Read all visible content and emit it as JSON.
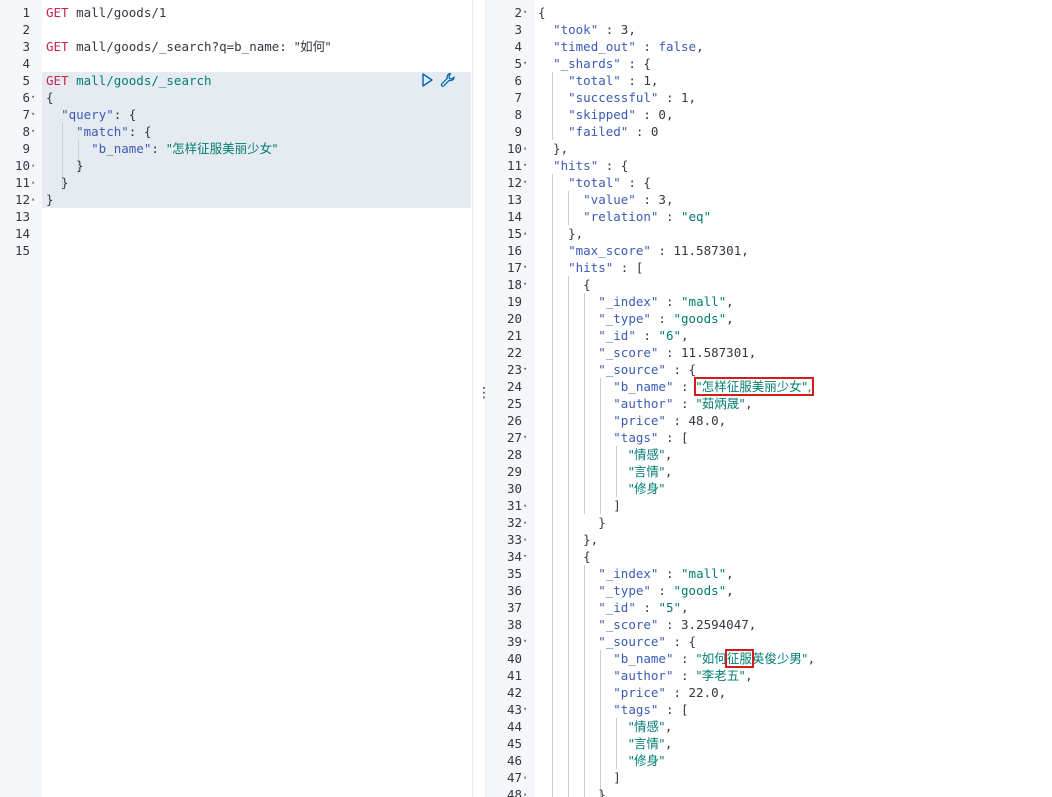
{
  "left_editor": {
    "lines": [
      {
        "n": "1",
        "code": [
          {
            "t": "GET",
            "c": "m"
          },
          {
            "t": " mall/goods/1",
            "c": "u"
          }
        ]
      },
      {
        "n": "2",
        "code": []
      },
      {
        "n": "3",
        "code": [
          {
            "t": "GET",
            "c": "m"
          },
          {
            "t": " mall/goods/_search?q=b_name: ",
            "c": "u"
          },
          {
            "t": "\"如何\"",
            "c": "u"
          }
        ]
      },
      {
        "n": "4",
        "code": []
      },
      {
        "n": "5",
        "code": [
          {
            "t": "GET",
            "c": "m"
          },
          {
            "t": " mall/goods/_search",
            "c": "s"
          }
        ]
      },
      {
        "n": "6",
        "fold": "▾",
        "code": [
          {
            "t": "{",
            "c": "p"
          }
        ]
      },
      {
        "n": "7",
        "fold": "▾",
        "code": [
          {
            "t": "  ",
            "c": "p"
          },
          {
            "t": "\"query\"",
            "c": "k"
          },
          {
            "t": ": {",
            "c": "p"
          }
        ]
      },
      {
        "n": "8",
        "fold": "▾",
        "code": [
          {
            "t": "    ",
            "c": "p"
          },
          {
            "t": "\"match\"",
            "c": "k"
          },
          {
            "t": ": {",
            "c": "p"
          }
        ]
      },
      {
        "n": "9",
        "code": [
          {
            "t": "      ",
            "c": "p"
          },
          {
            "t": "\"b_name\"",
            "c": "k"
          },
          {
            "t": ": ",
            "c": "p"
          },
          {
            "t": "\"怎样征服美丽少女\"",
            "c": "s"
          }
        ]
      },
      {
        "n": "10",
        "fold": "▴",
        "code": [
          {
            "t": "    }",
            "c": "p"
          }
        ]
      },
      {
        "n": "11",
        "fold": "▴",
        "code": [
          {
            "t": "  }",
            "c": "p"
          }
        ]
      },
      {
        "n": "12",
        "fold": "▴",
        "code": [
          {
            "t": "}",
            "c": "p"
          }
        ]
      },
      {
        "n": "13",
        "code": []
      },
      {
        "n": "14",
        "code": []
      },
      {
        "n": "15",
        "code": []
      }
    ]
  },
  "action_bar": {
    "run_icon": "play-icon",
    "settings_icon": "wrench-icon"
  },
  "divider": {
    "handle": "⋮"
  },
  "right_editor": {
    "lines": [
      {
        "n": "2",
        "fold": "▾",
        "code": [
          {
            "t": "{",
            "c": "p"
          }
        ]
      },
      {
        "n": "3",
        "code": [
          {
            "t": "  ",
            "c": "p"
          },
          {
            "t": "\"took\"",
            "c": "k"
          },
          {
            "t": " : ",
            "c": "p"
          },
          {
            "t": "3",
            "c": "n"
          },
          {
            "t": ",",
            "c": "p"
          }
        ]
      },
      {
        "n": "4",
        "code": [
          {
            "t": "  ",
            "c": "p"
          },
          {
            "t": "\"timed_out\"",
            "c": "k"
          },
          {
            "t": " : ",
            "c": "p"
          },
          {
            "t": "false",
            "c": "k"
          },
          {
            "t": ",",
            "c": "p"
          }
        ]
      },
      {
        "n": "5",
        "fold": "▾",
        "code": [
          {
            "t": "  ",
            "c": "p"
          },
          {
            "t": "\"_shards\"",
            "c": "k"
          },
          {
            "t": " : {",
            "c": "p"
          }
        ]
      },
      {
        "n": "6",
        "code": [
          {
            "t": "    ",
            "c": "p"
          },
          {
            "t": "\"total\"",
            "c": "k"
          },
          {
            "t": " : ",
            "c": "p"
          },
          {
            "t": "1",
            "c": "n"
          },
          {
            "t": ",",
            "c": "p"
          }
        ]
      },
      {
        "n": "7",
        "code": [
          {
            "t": "    ",
            "c": "p"
          },
          {
            "t": "\"successful\"",
            "c": "k"
          },
          {
            "t": " : ",
            "c": "p"
          },
          {
            "t": "1",
            "c": "n"
          },
          {
            "t": ",",
            "c": "p"
          }
        ]
      },
      {
        "n": "8",
        "code": [
          {
            "t": "    ",
            "c": "p"
          },
          {
            "t": "\"skipped\"",
            "c": "k"
          },
          {
            "t": " : ",
            "c": "p"
          },
          {
            "t": "0",
            "c": "n"
          },
          {
            "t": ",",
            "c": "p"
          }
        ]
      },
      {
        "n": "9",
        "code": [
          {
            "t": "    ",
            "c": "p"
          },
          {
            "t": "\"failed\"",
            "c": "k"
          },
          {
            "t": " : ",
            "c": "p"
          },
          {
            "t": "0",
            "c": "n"
          }
        ]
      },
      {
        "n": "10",
        "fold": "▴",
        "code": [
          {
            "t": "  },",
            "c": "p"
          }
        ]
      },
      {
        "n": "11",
        "fold": "▾",
        "code": [
          {
            "t": "  ",
            "c": "p"
          },
          {
            "t": "\"hits\"",
            "c": "k"
          },
          {
            "t": " : {",
            "c": "p"
          }
        ]
      },
      {
        "n": "12",
        "fold": "▾",
        "code": [
          {
            "t": "    ",
            "c": "p"
          },
          {
            "t": "\"total\"",
            "c": "k"
          },
          {
            "t": " : {",
            "c": "p"
          }
        ]
      },
      {
        "n": "13",
        "code": [
          {
            "t": "      ",
            "c": "p"
          },
          {
            "t": "\"value\"",
            "c": "k"
          },
          {
            "t": " : ",
            "c": "p"
          },
          {
            "t": "3",
            "c": "n"
          },
          {
            "t": ",",
            "c": "p"
          }
        ]
      },
      {
        "n": "14",
        "code": [
          {
            "t": "      ",
            "c": "p"
          },
          {
            "t": "\"relation\"",
            "c": "k"
          },
          {
            "t": " : ",
            "c": "p"
          },
          {
            "t": "\"eq\"",
            "c": "s"
          }
        ]
      },
      {
        "n": "15",
        "fold": "▴",
        "code": [
          {
            "t": "    },",
            "c": "p"
          }
        ]
      },
      {
        "n": "16",
        "code": [
          {
            "t": "    ",
            "c": "p"
          },
          {
            "t": "\"max_score\"",
            "c": "k"
          },
          {
            "t": " : ",
            "c": "p"
          },
          {
            "t": "11.587301",
            "c": "n"
          },
          {
            "t": ",",
            "c": "p"
          }
        ]
      },
      {
        "n": "17",
        "fold": "▾",
        "code": [
          {
            "t": "    ",
            "c": "p"
          },
          {
            "t": "\"hits\"",
            "c": "k"
          },
          {
            "t": " : [",
            "c": "p"
          }
        ]
      },
      {
        "n": "18",
        "fold": "▾",
        "code": [
          {
            "t": "      {",
            "c": "p"
          }
        ]
      },
      {
        "n": "19",
        "code": [
          {
            "t": "        ",
            "c": "p"
          },
          {
            "t": "\"_index\"",
            "c": "k"
          },
          {
            "t": " : ",
            "c": "p"
          },
          {
            "t": "\"mall\"",
            "c": "s"
          },
          {
            "t": ",",
            "c": "p"
          }
        ]
      },
      {
        "n": "20",
        "code": [
          {
            "t": "        ",
            "c": "p"
          },
          {
            "t": "\"_type\"",
            "c": "k"
          },
          {
            "t": " : ",
            "c": "p"
          },
          {
            "t": "\"goods\"",
            "c": "s"
          },
          {
            "t": ",",
            "c": "p"
          }
        ]
      },
      {
        "n": "21",
        "code": [
          {
            "t": "        ",
            "c": "p"
          },
          {
            "t": "\"_id\"",
            "c": "k"
          },
          {
            "t": " : ",
            "c": "p"
          },
          {
            "t": "\"6\"",
            "c": "s"
          },
          {
            "t": ",",
            "c": "p"
          }
        ]
      },
      {
        "n": "22",
        "code": [
          {
            "t": "        ",
            "c": "p"
          },
          {
            "t": "\"_score\"",
            "c": "k"
          },
          {
            "t": " : ",
            "c": "p"
          },
          {
            "t": "11.587301",
            "c": "n"
          },
          {
            "t": ",",
            "c": "p"
          }
        ]
      },
      {
        "n": "23",
        "fold": "▾",
        "code": [
          {
            "t": "        ",
            "c": "p"
          },
          {
            "t": "\"_source\"",
            "c": "k"
          },
          {
            "t": " : {",
            "c": "p"
          }
        ]
      },
      {
        "n": "24",
        "code": [
          {
            "t": "          ",
            "c": "p"
          },
          {
            "t": "\"b_name\"",
            "c": "k"
          },
          {
            "t": " : ",
            "c": "p"
          },
          {
            "t": "\"怎样征服美丽少女\",",
            "c": "s",
            "hl": true
          }
        ]
      },
      {
        "n": "25",
        "code": [
          {
            "t": "          ",
            "c": "p"
          },
          {
            "t": "\"author\"",
            "c": "k"
          },
          {
            "t": " : ",
            "c": "p"
          },
          {
            "t": "\"茹炳晟\"",
            "c": "s"
          },
          {
            "t": ",",
            "c": "p"
          }
        ]
      },
      {
        "n": "26",
        "code": [
          {
            "t": "          ",
            "c": "p"
          },
          {
            "t": "\"price\"",
            "c": "k"
          },
          {
            "t": " : ",
            "c": "p"
          },
          {
            "t": "48.0",
            "c": "n"
          },
          {
            "t": ",",
            "c": "p"
          }
        ]
      },
      {
        "n": "27",
        "fold": "▾",
        "code": [
          {
            "t": "          ",
            "c": "p"
          },
          {
            "t": "\"tags\"",
            "c": "k"
          },
          {
            "t": " : [",
            "c": "p"
          }
        ]
      },
      {
        "n": "28",
        "code": [
          {
            "t": "            ",
            "c": "p"
          },
          {
            "t": "\"情感\"",
            "c": "s"
          },
          {
            "t": ",",
            "c": "p"
          }
        ]
      },
      {
        "n": "29",
        "code": [
          {
            "t": "            ",
            "c": "p"
          },
          {
            "t": "\"言情\"",
            "c": "s"
          },
          {
            "t": ",",
            "c": "p"
          }
        ]
      },
      {
        "n": "30",
        "code": [
          {
            "t": "            ",
            "c": "p"
          },
          {
            "t": "\"修身\"",
            "c": "s"
          }
        ]
      },
      {
        "n": "31",
        "fold": "▴",
        "code": [
          {
            "t": "          ]",
            "c": "p"
          }
        ]
      },
      {
        "n": "32",
        "fold": "▴",
        "code": [
          {
            "t": "        }",
            "c": "p"
          }
        ]
      },
      {
        "n": "33",
        "fold": "▴",
        "code": [
          {
            "t": "      },",
            "c": "p"
          }
        ]
      },
      {
        "n": "34",
        "fold": "▾",
        "code": [
          {
            "t": "      {",
            "c": "p"
          }
        ]
      },
      {
        "n": "35",
        "code": [
          {
            "t": "        ",
            "c": "p"
          },
          {
            "t": "\"_index\"",
            "c": "k"
          },
          {
            "t": " : ",
            "c": "p"
          },
          {
            "t": "\"mall\"",
            "c": "s"
          },
          {
            "t": ",",
            "c": "p"
          }
        ]
      },
      {
        "n": "36",
        "code": [
          {
            "t": "        ",
            "c": "p"
          },
          {
            "t": "\"_type\"",
            "c": "k"
          },
          {
            "t": " : ",
            "c": "p"
          },
          {
            "t": "\"goods\"",
            "c": "s"
          },
          {
            "t": ",",
            "c": "p"
          }
        ]
      },
      {
        "n": "37",
        "code": [
          {
            "t": "        ",
            "c": "p"
          },
          {
            "t": "\"_id\"",
            "c": "k"
          },
          {
            "t": " : ",
            "c": "p"
          },
          {
            "t": "\"5\"",
            "c": "s"
          },
          {
            "t": ",",
            "c": "p"
          }
        ]
      },
      {
        "n": "38",
        "code": [
          {
            "t": "        ",
            "c": "p"
          },
          {
            "t": "\"_score\"",
            "c": "k"
          },
          {
            "t": " : ",
            "c": "p"
          },
          {
            "t": "3.2594047",
            "c": "n"
          },
          {
            "t": ",",
            "c": "p"
          }
        ]
      },
      {
        "n": "39",
        "fold": "▾",
        "code": [
          {
            "t": "        ",
            "c": "p"
          },
          {
            "t": "\"_source\"",
            "c": "k"
          },
          {
            "t": " : {",
            "c": "p"
          }
        ]
      },
      {
        "n": "40",
        "code": [
          {
            "t": "          ",
            "c": "p"
          },
          {
            "t": "\"b_name\"",
            "c": "k"
          },
          {
            "t": " : ",
            "c": "p"
          },
          {
            "t": "\"如何",
            "c": "s"
          },
          {
            "t": "征服",
            "c": "s",
            "hl": true
          },
          {
            "t": "英俊少男\"",
            "c": "s"
          },
          {
            "t": ",",
            "c": "p"
          }
        ]
      },
      {
        "n": "41",
        "code": [
          {
            "t": "          ",
            "c": "p"
          },
          {
            "t": "\"author\"",
            "c": "k"
          },
          {
            "t": " : ",
            "c": "p"
          },
          {
            "t": "\"李老五\"",
            "c": "s"
          },
          {
            "t": ",",
            "c": "p"
          }
        ]
      },
      {
        "n": "42",
        "code": [
          {
            "t": "          ",
            "c": "p"
          },
          {
            "t": "\"price\"",
            "c": "k"
          },
          {
            "t": " : ",
            "c": "p"
          },
          {
            "t": "22.0",
            "c": "n"
          },
          {
            "t": ",",
            "c": "p"
          }
        ]
      },
      {
        "n": "43",
        "fold": "▾",
        "code": [
          {
            "t": "          ",
            "c": "p"
          },
          {
            "t": "\"tags\"",
            "c": "k"
          },
          {
            "t": " : [",
            "c": "p"
          }
        ]
      },
      {
        "n": "44",
        "code": [
          {
            "t": "            ",
            "c": "p"
          },
          {
            "t": "\"情感\"",
            "c": "s"
          },
          {
            "t": ",",
            "c": "p"
          }
        ]
      },
      {
        "n": "45",
        "code": [
          {
            "t": "            ",
            "c": "p"
          },
          {
            "t": "\"言情\"",
            "c": "s"
          },
          {
            "t": ",",
            "c": "p"
          }
        ]
      },
      {
        "n": "46",
        "code": [
          {
            "t": "            ",
            "c": "p"
          },
          {
            "t": "\"修身\"",
            "c": "s"
          }
        ]
      },
      {
        "n": "47",
        "fold": "▴",
        "code": [
          {
            "t": "          ]",
            "c": "p"
          }
        ]
      },
      {
        "n": "48",
        "fold": "▴",
        "code": [
          {
            "t": "        }",
            "c": "p"
          }
        ]
      }
    ]
  },
  "colors": {
    "key": "#3b5bb5",
    "string": "#017d73",
    "method": "#c7254e",
    "selected_block": "#e6ebf2",
    "highlight_box": "#d31c1c"
  }
}
